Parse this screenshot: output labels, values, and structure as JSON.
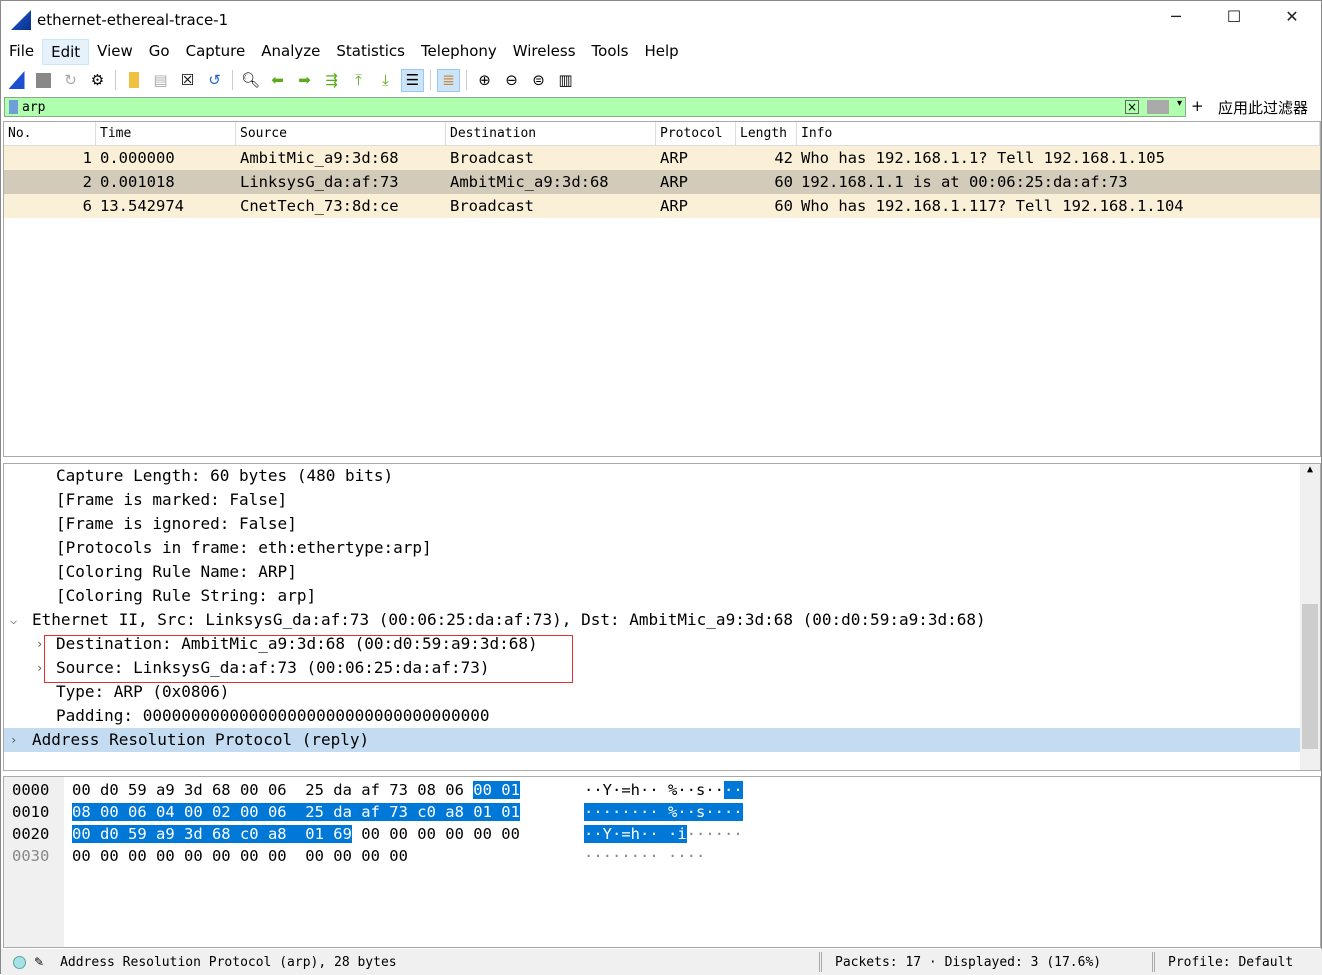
{
  "window": {
    "title": "ethernet-ethereal-trace-1",
    "minimize": "─",
    "maximize": "☐",
    "close": "✕"
  },
  "menu": [
    "File",
    "Edit",
    "View",
    "Go",
    "Capture",
    "Analyze",
    "Statistics",
    "Telephony",
    "Wireless",
    "Tools",
    "Help"
  ],
  "toolbar": [
    "shark-fin-start-icon",
    "stop-icon",
    "restart-icon",
    "options-gear-icon",
    "open-folder-icon",
    "save-file-icon",
    "close-file-icon",
    "reload-icon",
    "find-icon",
    "back-arrow-icon",
    "forward-arrow-icon",
    "go-to-packet-icon",
    "first-packet-icon",
    "last-packet-icon",
    "autoscroll-icon",
    "colorize-icon",
    "zoom-in-icon",
    "zoom-out-icon",
    "normal-size-icon",
    "resize-columns-icon"
  ],
  "filter": {
    "value": "arp",
    "plus": "+",
    "apply_label": "应用此过滤器",
    "color": "#afffaf"
  },
  "packet_list": {
    "columns": [
      "No.",
      "Time",
      "Source",
      "Destination",
      "Protocol",
      "Length",
      "Info"
    ],
    "rows": [
      {
        "no": "1",
        "time": "0.000000",
        "src": "AmbitMic_a9:3d:68",
        "dst": "Broadcast",
        "proto": "ARP",
        "len": "42",
        "info": "Who has 192.168.1.1? Tell 192.168.1.105",
        "color": "#faf0d7"
      },
      {
        "no": "2",
        "time": "0.001018",
        "src": "LinksysG_da:af:73",
        "dst": "AmbitMic_a9:3d:68",
        "proto": "ARP",
        "len": "60",
        "info": "192.168.1.1 is at 00:06:25:da:af:73",
        "color": "#d3cbb9"
      },
      {
        "no": "6",
        "time": "13.542974",
        "src": "CnetTech_73:8d:ce",
        "dst": "Broadcast",
        "proto": "ARP",
        "len": "60",
        "info": "Who has 192.168.1.117? Tell 192.168.1.104",
        "color": "#faf0d7"
      }
    ]
  },
  "details": [
    "Capture Length: 60 bytes (480 bits)",
    "[Frame is marked: False]",
    "[Frame is ignored: False]",
    "[Protocols in frame: eth:ethertype:arp]",
    "[Coloring Rule Name: ARP]",
    "[Coloring Rule String: arp]",
    "Ethernet II, Src: LinksysG_da:af:73 (00:06:25:da:af:73), Dst: AmbitMic_a9:3d:68 (00:d0:59:a9:3d:68)",
    "Destination: AmbitMic_a9:3d:68 (00:d0:59:a9:3d:68)",
    "Source: LinksysG_da:af:73 (00:06:25:da:af:73)",
    "Type: ARP (0x0806)",
    "Padding: 000000000000000000000000000000000000",
    "Address Resolution Protocol (reply)"
  ],
  "hex": {
    "offsets": [
      "0000",
      "0010",
      "0020",
      "0030"
    ],
    "rows": [
      {
        "plain": "00 d0 59 a9 3d 68 00 06  25 da af 73 08 06 ",
        "sel": "00 01",
        "rest": "",
        "a_plain": "··Y·=h·· %··s··",
        "a_sel": "··",
        "a_rest": ""
      },
      {
        "plain": "",
        "sel": "08 00 06 04 00 02 00 06  25 da af 73 c0 a8 01 01",
        "rest": "",
        "a_plain": "",
        "a_sel": "········ %··s····",
        "a_rest": ""
      },
      {
        "plain": "",
        "sel": "00 d0 59 a9 3d 68 c0 a8  01 69",
        "rest": " 00 00 00 00 00 00",
        "a_plain": "",
        "a_sel": "··Y·=h·· ·i",
        "a_rest": "······"
      },
      {
        "plain": "00 00 00 00 00 00 00 00  00 00 00 00",
        "sel": "",
        "rest": "",
        "a_plain": "",
        "a_sel": "",
        "a_rest": "········ ····"
      }
    ]
  },
  "status": {
    "info": "Address Resolution Protocol (arp), 28 bytes",
    "packets": "Packets: 17 · Displayed: 3 (17.6%)",
    "profile": "Profile: Default"
  }
}
